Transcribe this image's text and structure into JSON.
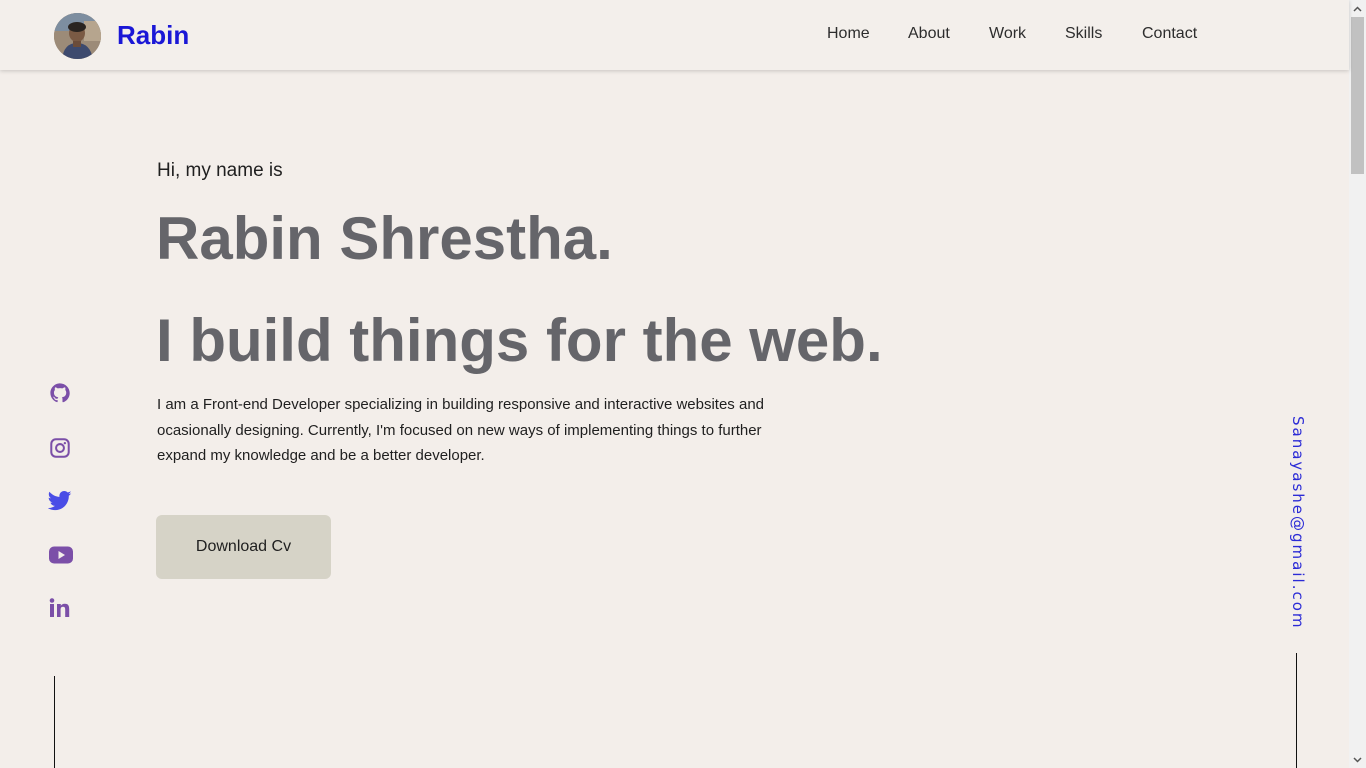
{
  "header": {
    "brand": "Rabin",
    "nav": [
      "Home",
      "About",
      "Work",
      "Skills",
      "Contact"
    ]
  },
  "hero": {
    "greeting": "Hi, my name is",
    "name": "Rabin Shrestha.",
    "tagline": "I build things for the web.",
    "bio": "I am a Front-end Developer specializing in building responsive and interactive websites and ocasionally designing. Currently, I'm focused on new ways of implementing things to further expand my knowledge and be a better developer.",
    "cv_button": "Download Cv"
  },
  "social_icons": [
    "github-icon",
    "instagram-icon",
    "twitter-icon",
    "youtube-icon",
    "linkedin-icon"
  ],
  "email": "Sanayashe@gmail.com",
  "colors": {
    "background": "#f3eeea",
    "brand": "#1a17d6",
    "heading": "#65656a",
    "icon": "#7b4fa8",
    "twitter": "#4a4de6",
    "email": "#2b2bd6",
    "button": "#d6d3c7"
  }
}
